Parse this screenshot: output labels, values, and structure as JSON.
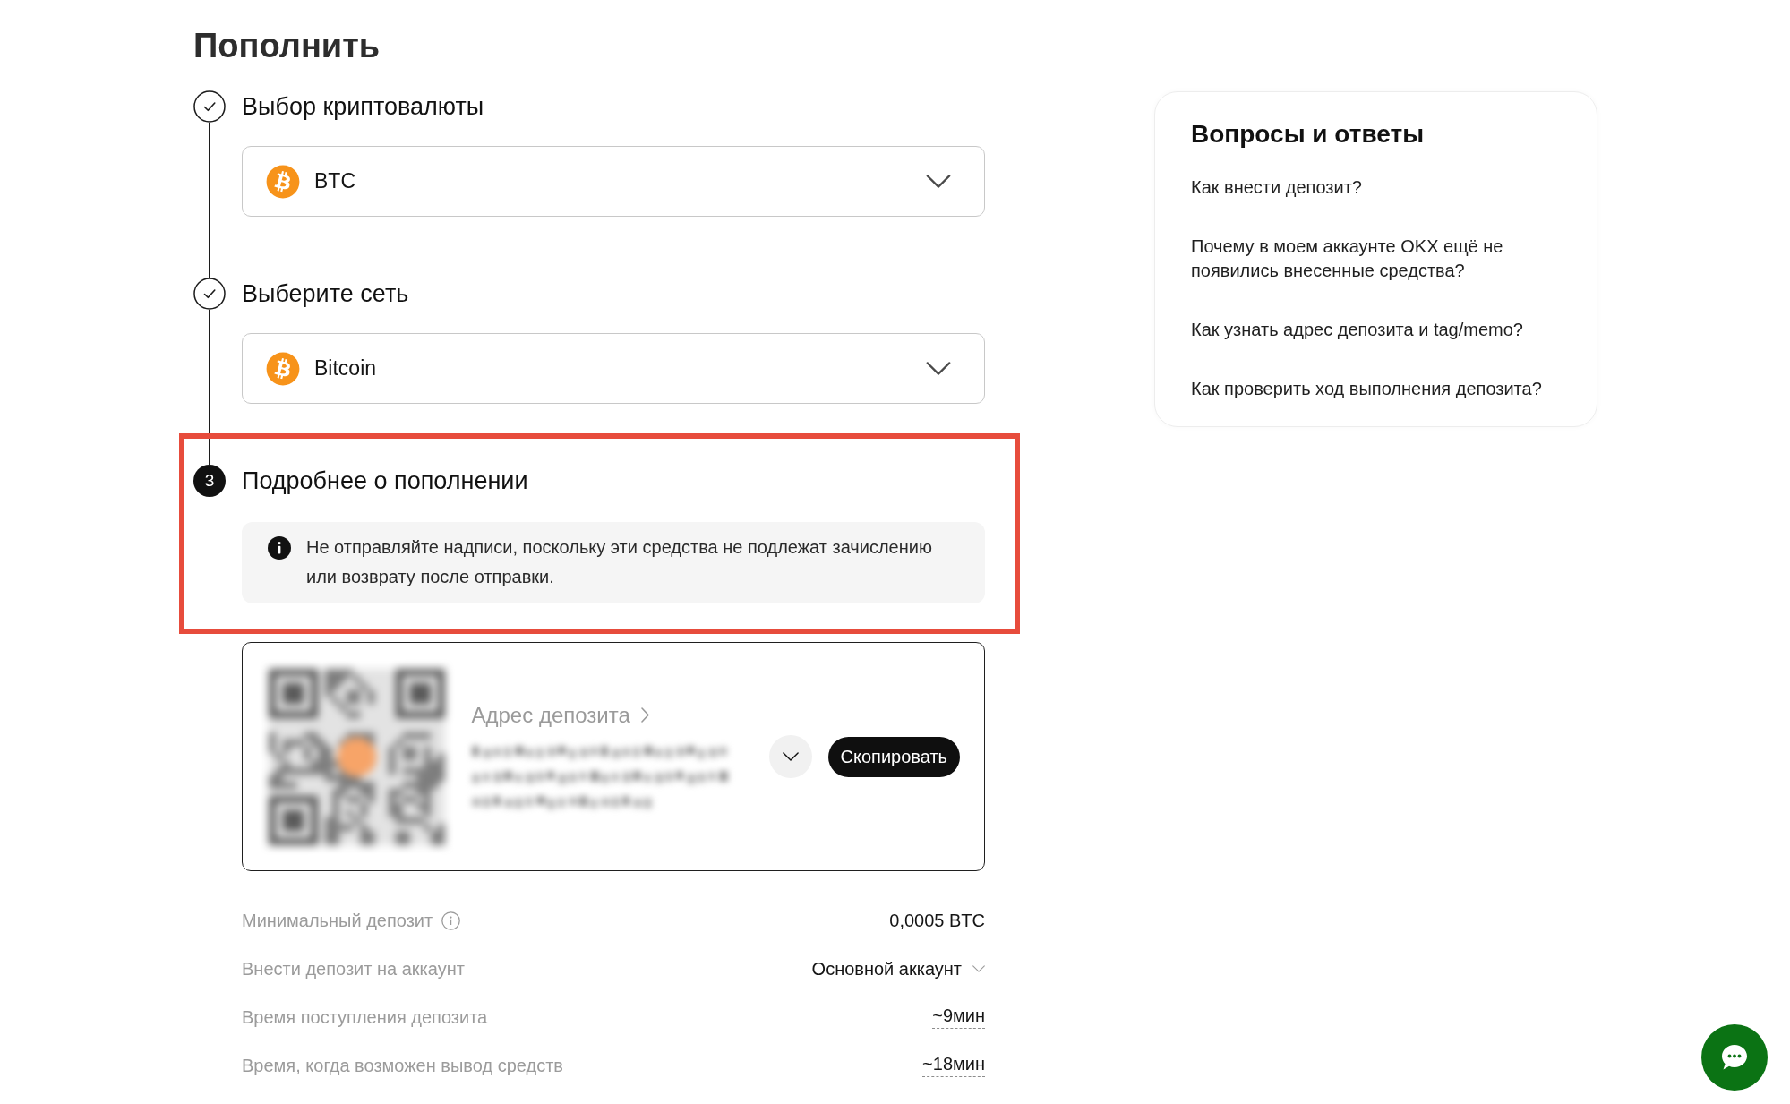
{
  "page": {
    "title": "Пополнить"
  },
  "steps": [
    {
      "title": "Выбор криптовалюты",
      "done": true,
      "highlighted": false,
      "select": {
        "value": "BTC"
      }
    },
    {
      "title": "Выберите сеть",
      "done": true,
      "highlighted": false,
      "select": {
        "value": "Bitcoin"
      }
    },
    {
      "title": "Подробнее о пополнении",
      "done": false,
      "number": "3",
      "highlighted": true,
      "notice": "Не отправляйте надписи, поскольку эти средства не подлежат зачислению или возврату после отправки."
    }
  ],
  "deposit_address": {
    "label": "Адрес депозита",
    "copy_button": "Скопировать"
  },
  "details": [
    {
      "kind": "info",
      "label": "Минимальный депозит",
      "value": "0,0005 BTC"
    },
    {
      "kind": "select",
      "label": "Внести депозит на аккаунт",
      "value": "Основной аккаунт"
    },
    {
      "kind": "estimate",
      "label": "Время поступления депозита",
      "value": "~9мин"
    },
    {
      "kind": "estimate",
      "label": "Время, когда возможен вывод средств",
      "value": "~18мин"
    }
  ],
  "faq": {
    "title": "Вопросы и ответы",
    "items": [
      "Как внести депозит?",
      "Почему в моем аккаунте OKX ещё не появились внесенные средства?",
      "Как узнать адрес депозита и tag/memo?",
      "Как проверить ход выполнения депозита?"
    ]
  }
}
